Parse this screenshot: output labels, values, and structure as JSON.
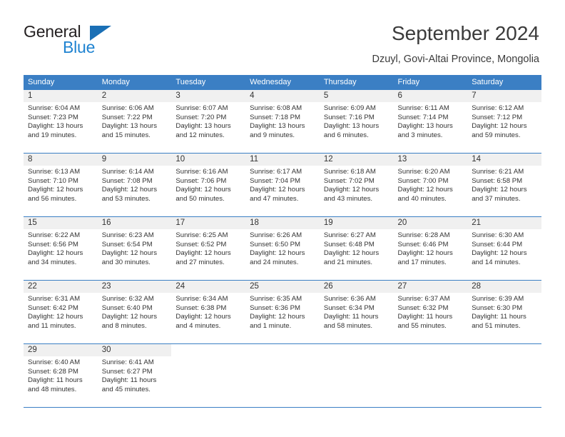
{
  "brand": {
    "line1": "General",
    "line2": "Blue",
    "accent_color": "#1f83d1",
    "triangle_color": "#1a6fb5"
  },
  "header": {
    "title": "September 2024",
    "subtitle": "Dzuyl, Govi-Altai Province, Mongolia"
  },
  "calendar": {
    "header_bg": "#3b7fc4",
    "daynum_bg": "#f0f0f0",
    "weekday_headers": [
      "Sunday",
      "Monday",
      "Tuesday",
      "Wednesday",
      "Thursday",
      "Friday",
      "Saturday"
    ],
    "weeks": [
      [
        {
          "day": "1",
          "sunrise": "Sunrise: 6:04 AM",
          "sunset": "Sunset: 7:23 PM",
          "daylight": "Daylight: 13 hours and 19 minutes."
        },
        {
          "day": "2",
          "sunrise": "Sunrise: 6:06 AM",
          "sunset": "Sunset: 7:22 PM",
          "daylight": "Daylight: 13 hours and 15 minutes."
        },
        {
          "day": "3",
          "sunrise": "Sunrise: 6:07 AM",
          "sunset": "Sunset: 7:20 PM",
          "daylight": "Daylight: 13 hours and 12 minutes."
        },
        {
          "day": "4",
          "sunrise": "Sunrise: 6:08 AM",
          "sunset": "Sunset: 7:18 PM",
          "daylight": "Daylight: 13 hours and 9 minutes."
        },
        {
          "day": "5",
          "sunrise": "Sunrise: 6:09 AM",
          "sunset": "Sunset: 7:16 PM",
          "daylight": "Daylight: 13 hours and 6 minutes."
        },
        {
          "day": "6",
          "sunrise": "Sunrise: 6:11 AM",
          "sunset": "Sunset: 7:14 PM",
          "daylight": "Daylight: 13 hours and 3 minutes."
        },
        {
          "day": "7",
          "sunrise": "Sunrise: 6:12 AM",
          "sunset": "Sunset: 7:12 PM",
          "daylight": "Daylight: 12 hours and 59 minutes."
        }
      ],
      [
        {
          "day": "8",
          "sunrise": "Sunrise: 6:13 AM",
          "sunset": "Sunset: 7:10 PM",
          "daylight": "Daylight: 12 hours and 56 minutes."
        },
        {
          "day": "9",
          "sunrise": "Sunrise: 6:14 AM",
          "sunset": "Sunset: 7:08 PM",
          "daylight": "Daylight: 12 hours and 53 minutes."
        },
        {
          "day": "10",
          "sunrise": "Sunrise: 6:16 AM",
          "sunset": "Sunset: 7:06 PM",
          "daylight": "Daylight: 12 hours and 50 minutes."
        },
        {
          "day": "11",
          "sunrise": "Sunrise: 6:17 AM",
          "sunset": "Sunset: 7:04 PM",
          "daylight": "Daylight: 12 hours and 47 minutes."
        },
        {
          "day": "12",
          "sunrise": "Sunrise: 6:18 AM",
          "sunset": "Sunset: 7:02 PM",
          "daylight": "Daylight: 12 hours and 43 minutes."
        },
        {
          "day": "13",
          "sunrise": "Sunrise: 6:20 AM",
          "sunset": "Sunset: 7:00 PM",
          "daylight": "Daylight: 12 hours and 40 minutes."
        },
        {
          "day": "14",
          "sunrise": "Sunrise: 6:21 AM",
          "sunset": "Sunset: 6:58 PM",
          "daylight": "Daylight: 12 hours and 37 minutes."
        }
      ],
      [
        {
          "day": "15",
          "sunrise": "Sunrise: 6:22 AM",
          "sunset": "Sunset: 6:56 PM",
          "daylight": "Daylight: 12 hours and 34 minutes."
        },
        {
          "day": "16",
          "sunrise": "Sunrise: 6:23 AM",
          "sunset": "Sunset: 6:54 PM",
          "daylight": "Daylight: 12 hours and 30 minutes."
        },
        {
          "day": "17",
          "sunrise": "Sunrise: 6:25 AM",
          "sunset": "Sunset: 6:52 PM",
          "daylight": "Daylight: 12 hours and 27 minutes."
        },
        {
          "day": "18",
          "sunrise": "Sunrise: 6:26 AM",
          "sunset": "Sunset: 6:50 PM",
          "daylight": "Daylight: 12 hours and 24 minutes."
        },
        {
          "day": "19",
          "sunrise": "Sunrise: 6:27 AM",
          "sunset": "Sunset: 6:48 PM",
          "daylight": "Daylight: 12 hours and 21 minutes."
        },
        {
          "day": "20",
          "sunrise": "Sunrise: 6:28 AM",
          "sunset": "Sunset: 6:46 PM",
          "daylight": "Daylight: 12 hours and 17 minutes."
        },
        {
          "day": "21",
          "sunrise": "Sunrise: 6:30 AM",
          "sunset": "Sunset: 6:44 PM",
          "daylight": "Daylight: 12 hours and 14 minutes."
        }
      ],
      [
        {
          "day": "22",
          "sunrise": "Sunrise: 6:31 AM",
          "sunset": "Sunset: 6:42 PM",
          "daylight": "Daylight: 12 hours and 11 minutes."
        },
        {
          "day": "23",
          "sunrise": "Sunrise: 6:32 AM",
          "sunset": "Sunset: 6:40 PM",
          "daylight": "Daylight: 12 hours and 8 minutes."
        },
        {
          "day": "24",
          "sunrise": "Sunrise: 6:34 AM",
          "sunset": "Sunset: 6:38 PM",
          "daylight": "Daylight: 12 hours and 4 minutes."
        },
        {
          "day": "25",
          "sunrise": "Sunrise: 6:35 AM",
          "sunset": "Sunset: 6:36 PM",
          "daylight": "Daylight: 12 hours and 1 minute."
        },
        {
          "day": "26",
          "sunrise": "Sunrise: 6:36 AM",
          "sunset": "Sunset: 6:34 PM",
          "daylight": "Daylight: 11 hours and 58 minutes."
        },
        {
          "day": "27",
          "sunrise": "Sunrise: 6:37 AM",
          "sunset": "Sunset: 6:32 PM",
          "daylight": "Daylight: 11 hours and 55 minutes."
        },
        {
          "day": "28",
          "sunrise": "Sunrise: 6:39 AM",
          "sunset": "Sunset: 6:30 PM",
          "daylight": "Daylight: 11 hours and 51 minutes."
        }
      ],
      [
        {
          "day": "29",
          "sunrise": "Sunrise: 6:40 AM",
          "sunset": "Sunset: 6:28 PM",
          "daylight": "Daylight: 11 hours and 48 minutes."
        },
        {
          "day": "30",
          "sunrise": "Sunrise: 6:41 AM",
          "sunset": "Sunset: 6:27 PM",
          "daylight": "Daylight: 11 hours and 45 minutes."
        },
        {
          "day": "",
          "sunrise": "",
          "sunset": "",
          "daylight": ""
        },
        {
          "day": "",
          "sunrise": "",
          "sunset": "",
          "daylight": ""
        },
        {
          "day": "",
          "sunrise": "",
          "sunset": "",
          "daylight": ""
        },
        {
          "day": "",
          "sunrise": "",
          "sunset": "",
          "daylight": ""
        },
        {
          "day": "",
          "sunrise": "",
          "sunset": "",
          "daylight": ""
        }
      ]
    ]
  }
}
